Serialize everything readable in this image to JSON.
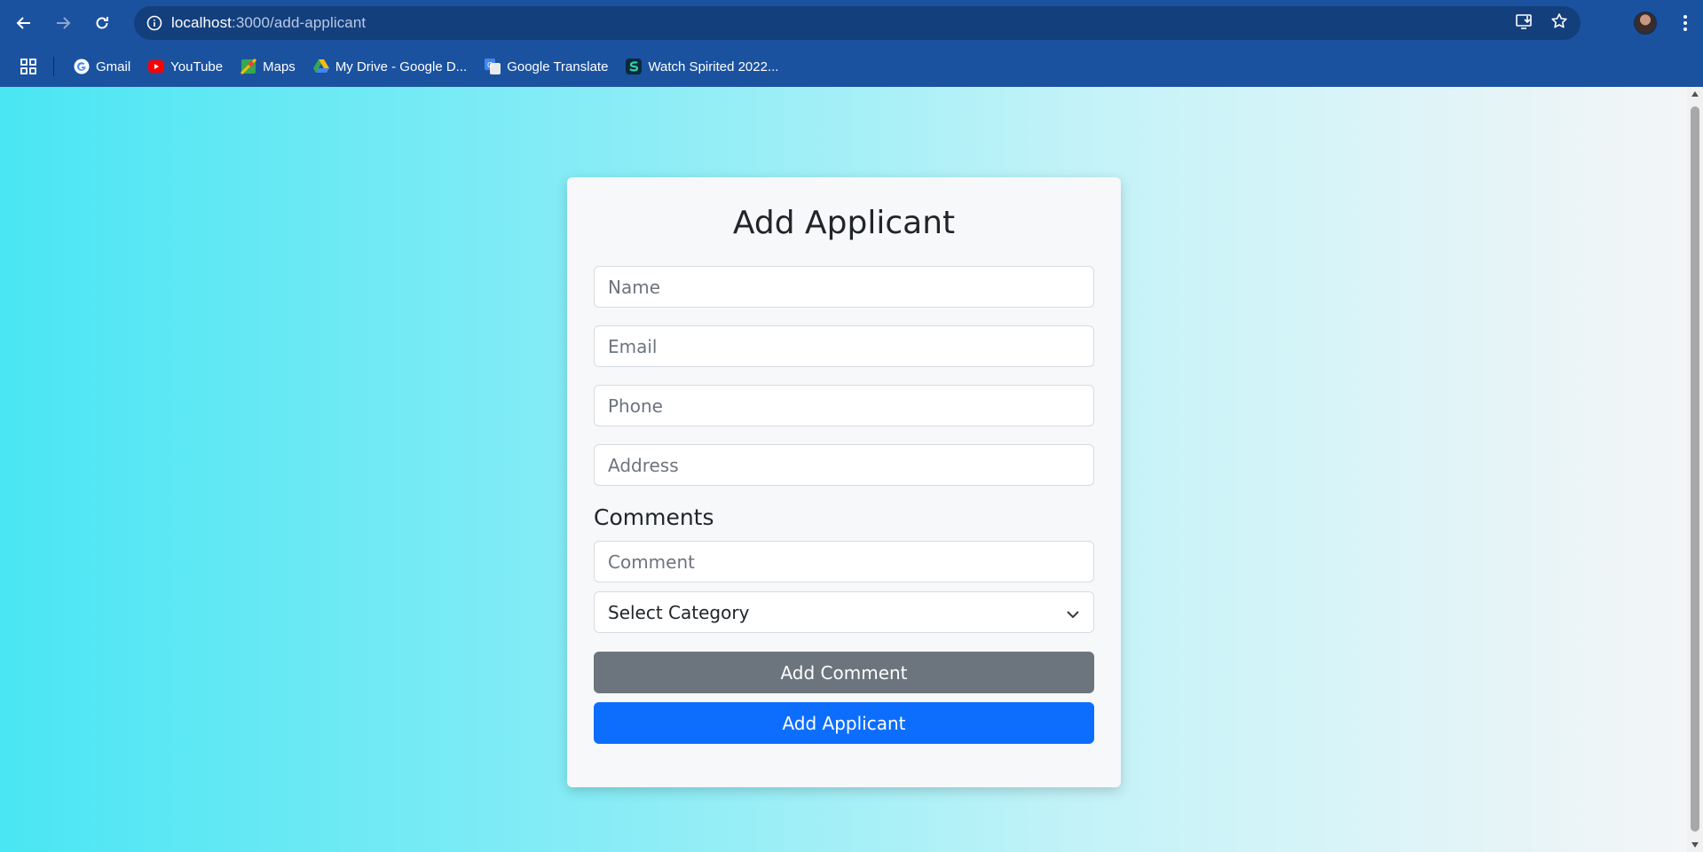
{
  "browser": {
    "url_host": "localhost",
    "url_path": ":3000/add-applicant",
    "bookmarks": [
      {
        "label": "Gmail",
        "icon": "google-icon"
      },
      {
        "label": "YouTube",
        "icon": "youtube-icon"
      },
      {
        "label": "Maps",
        "icon": "maps-icon"
      },
      {
        "label": "My Drive - Google D...",
        "icon": "drive-icon"
      },
      {
        "label": "Google Translate",
        "icon": "translate-icon"
      },
      {
        "label": "Watch Spirited 2022...",
        "icon": "site-s-icon"
      }
    ]
  },
  "form": {
    "title": "Add Applicant",
    "name_placeholder": "Name",
    "email_placeholder": "Email",
    "phone_placeholder": "Phone",
    "address_placeholder": "Address",
    "comments_heading": "Comments",
    "comment_placeholder": "Comment",
    "category_selected": "Select Category",
    "add_comment_label": "Add Comment",
    "add_applicant_label": "Add Applicant"
  },
  "colors": {
    "chrome": "#1a52a0",
    "primary_button": "#0d6efd",
    "secondary_button": "#6c757d"
  }
}
